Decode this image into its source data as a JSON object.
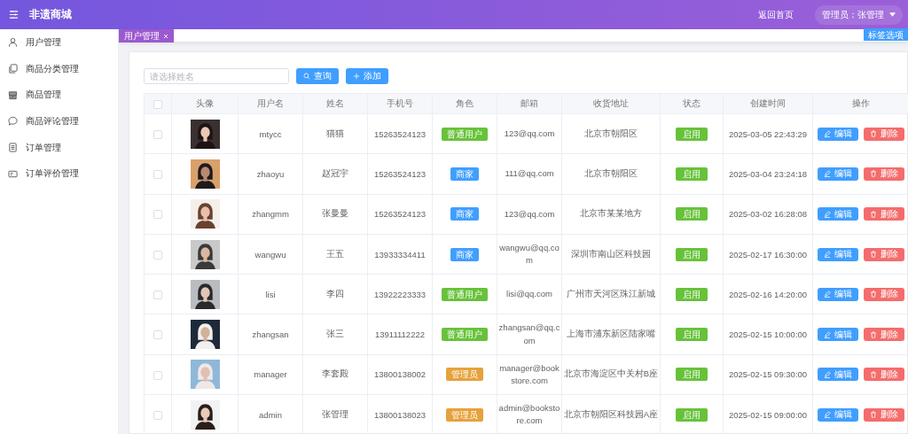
{
  "app": {
    "title": "非遗商城",
    "home_link": "返回首页",
    "user_menu": "管理员：张管理"
  },
  "sidebar": {
    "items": [
      {
        "label": "用户管理",
        "selected": false
      },
      {
        "label": "商品分类管理",
        "selected": false
      },
      {
        "label": "商品管理",
        "selected": false
      },
      {
        "label": "商品评论管理",
        "selected": false
      },
      {
        "label": "订单管理",
        "selected": false
      },
      {
        "label": "订单评价管理",
        "selected": false
      }
    ]
  },
  "tabs": [
    {
      "label": "用户管理",
      "selected": true
    }
  ],
  "tab_options": "标签选项",
  "search": {
    "placeholder": "请选择姓名"
  },
  "buttons": {
    "search": "查询",
    "add": "添加"
  },
  "table": {
    "select_all": {
      "checked": false
    },
    "columns": [
      "头像",
      "用户名",
      "姓名",
      "手机号",
      "角色",
      "邮箱",
      "收货地址",
      "状态",
      "创建时间",
      "操作"
    ],
    "rows": [
      {
        "checked": false,
        "username": "mtycc",
        "name": "猫猫",
        "phone": "15263524123",
        "role": {
          "label": "普通用户",
          "kind": "user"
        },
        "email": "123@qq.com",
        "address": "北京市朝阳区",
        "status": {
          "label": "启用",
          "enabled": true
        },
        "created": "2025-03-05 22:43:29",
        "edit": "编辑",
        "delete": "删除"
      },
      {
        "checked": false,
        "username": "zhaoyu",
        "name": "赵冠宇",
        "phone": "15263524123",
        "role": {
          "label": "商家",
          "kind": "merchant"
        },
        "email": "111@qq.com",
        "address": "北京市朝阳区",
        "status": {
          "label": "启用",
          "enabled": true
        },
        "created": "2025-03-04 23:24:18",
        "edit": "编辑",
        "delete": "删除"
      },
      {
        "checked": false,
        "username": "zhangmm",
        "name": "张曼曼",
        "phone": "15263524123",
        "role": {
          "label": "商家",
          "kind": "merchant"
        },
        "email": "123@qq.com",
        "address": "北京市某某地方",
        "status": {
          "label": "启用",
          "enabled": true
        },
        "created": "2025-03-02 16:28:08",
        "edit": "编辑",
        "delete": "删除"
      },
      {
        "checked": false,
        "username": "wangwu",
        "name": "王五",
        "phone": "13933334411",
        "role": {
          "label": "商家",
          "kind": "merchant"
        },
        "email": "wangwu@qq.com",
        "address": "深圳市南山区科技园",
        "status": {
          "label": "启用",
          "enabled": true
        },
        "created": "2025-02-17 16:30:00",
        "edit": "编辑",
        "delete": "删除"
      },
      {
        "checked": false,
        "username": "lisi",
        "name": "李四",
        "phone": "13922223333",
        "role": {
          "label": "普通用户",
          "kind": "user"
        },
        "email": "lisi@qq.com",
        "address": "广州市天河区珠江新城",
        "status": {
          "label": "启用",
          "enabled": true
        },
        "created": "2025-02-16 14:20:00",
        "edit": "编辑",
        "delete": "删除"
      },
      {
        "checked": false,
        "username": "zhangsan",
        "name": "张三",
        "phone": "13911112222",
        "role": {
          "label": "普通用户",
          "kind": "user"
        },
        "email": "zhangsan@qq.com",
        "address": "上海市浦东新区陆家嘴",
        "status": {
          "label": "启用",
          "enabled": true
        },
        "created": "2025-02-15 10:00:00",
        "edit": "编辑",
        "delete": "删除"
      },
      {
        "checked": false,
        "username": "manager",
        "name": "李套殿",
        "phone": "13800138002",
        "role": {
          "label": "管理员",
          "kind": "admin"
        },
        "email": "manager@bookstore.com",
        "address": "北京市海淀区中关村B座",
        "status": {
          "label": "启用",
          "enabled": true
        },
        "created": "2025-02-15 09:30:00",
        "edit": "编辑",
        "delete": "删除"
      },
      {
        "checked": false,
        "username": "admin",
        "name": "张管理",
        "phone": "13800138023",
        "role": {
          "label": "管理员",
          "kind": "admin"
        },
        "email": "admin@bookstore.com",
        "address": "北京市朝阳区科技园A座",
        "status": {
          "label": "启用",
          "enabled": true
        },
        "created": "2025-02-15 09:00:00",
        "edit": "编辑",
        "delete": "删除"
      }
    ]
  }
}
